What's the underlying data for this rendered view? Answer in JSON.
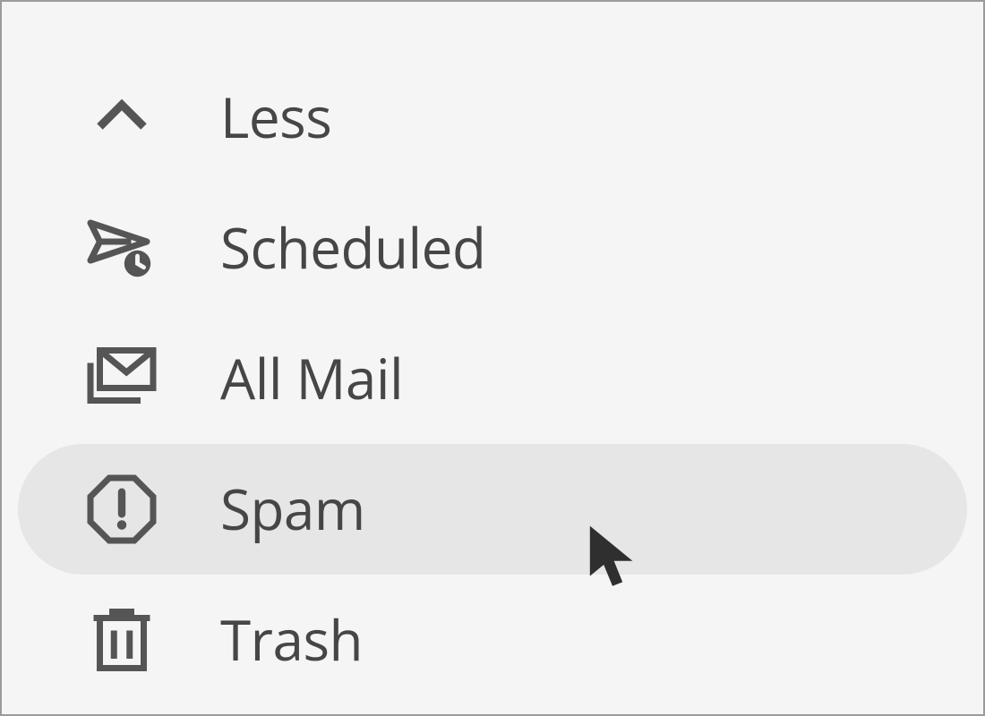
{
  "sidebar": {
    "items": [
      {
        "id": "less",
        "label": "Less",
        "icon": "chevron-up-icon",
        "selected": false
      },
      {
        "id": "scheduled",
        "label": "Scheduled",
        "icon": "scheduled-send-icon",
        "selected": false
      },
      {
        "id": "all-mail",
        "label": "All Mail",
        "icon": "all-mail-icon",
        "selected": false
      },
      {
        "id": "spam",
        "label": "Spam",
        "icon": "spam-octagon-icon",
        "selected": true
      },
      {
        "id": "trash",
        "label": "Trash",
        "icon": "trash-icon",
        "selected": false
      }
    ]
  },
  "colors": {
    "icon": "#555555",
    "text": "#464646",
    "selected": "#e6e6e6",
    "bg": "#f5f5f5",
    "border": "#9b9b9b",
    "cursor": "#2f2f2f"
  }
}
